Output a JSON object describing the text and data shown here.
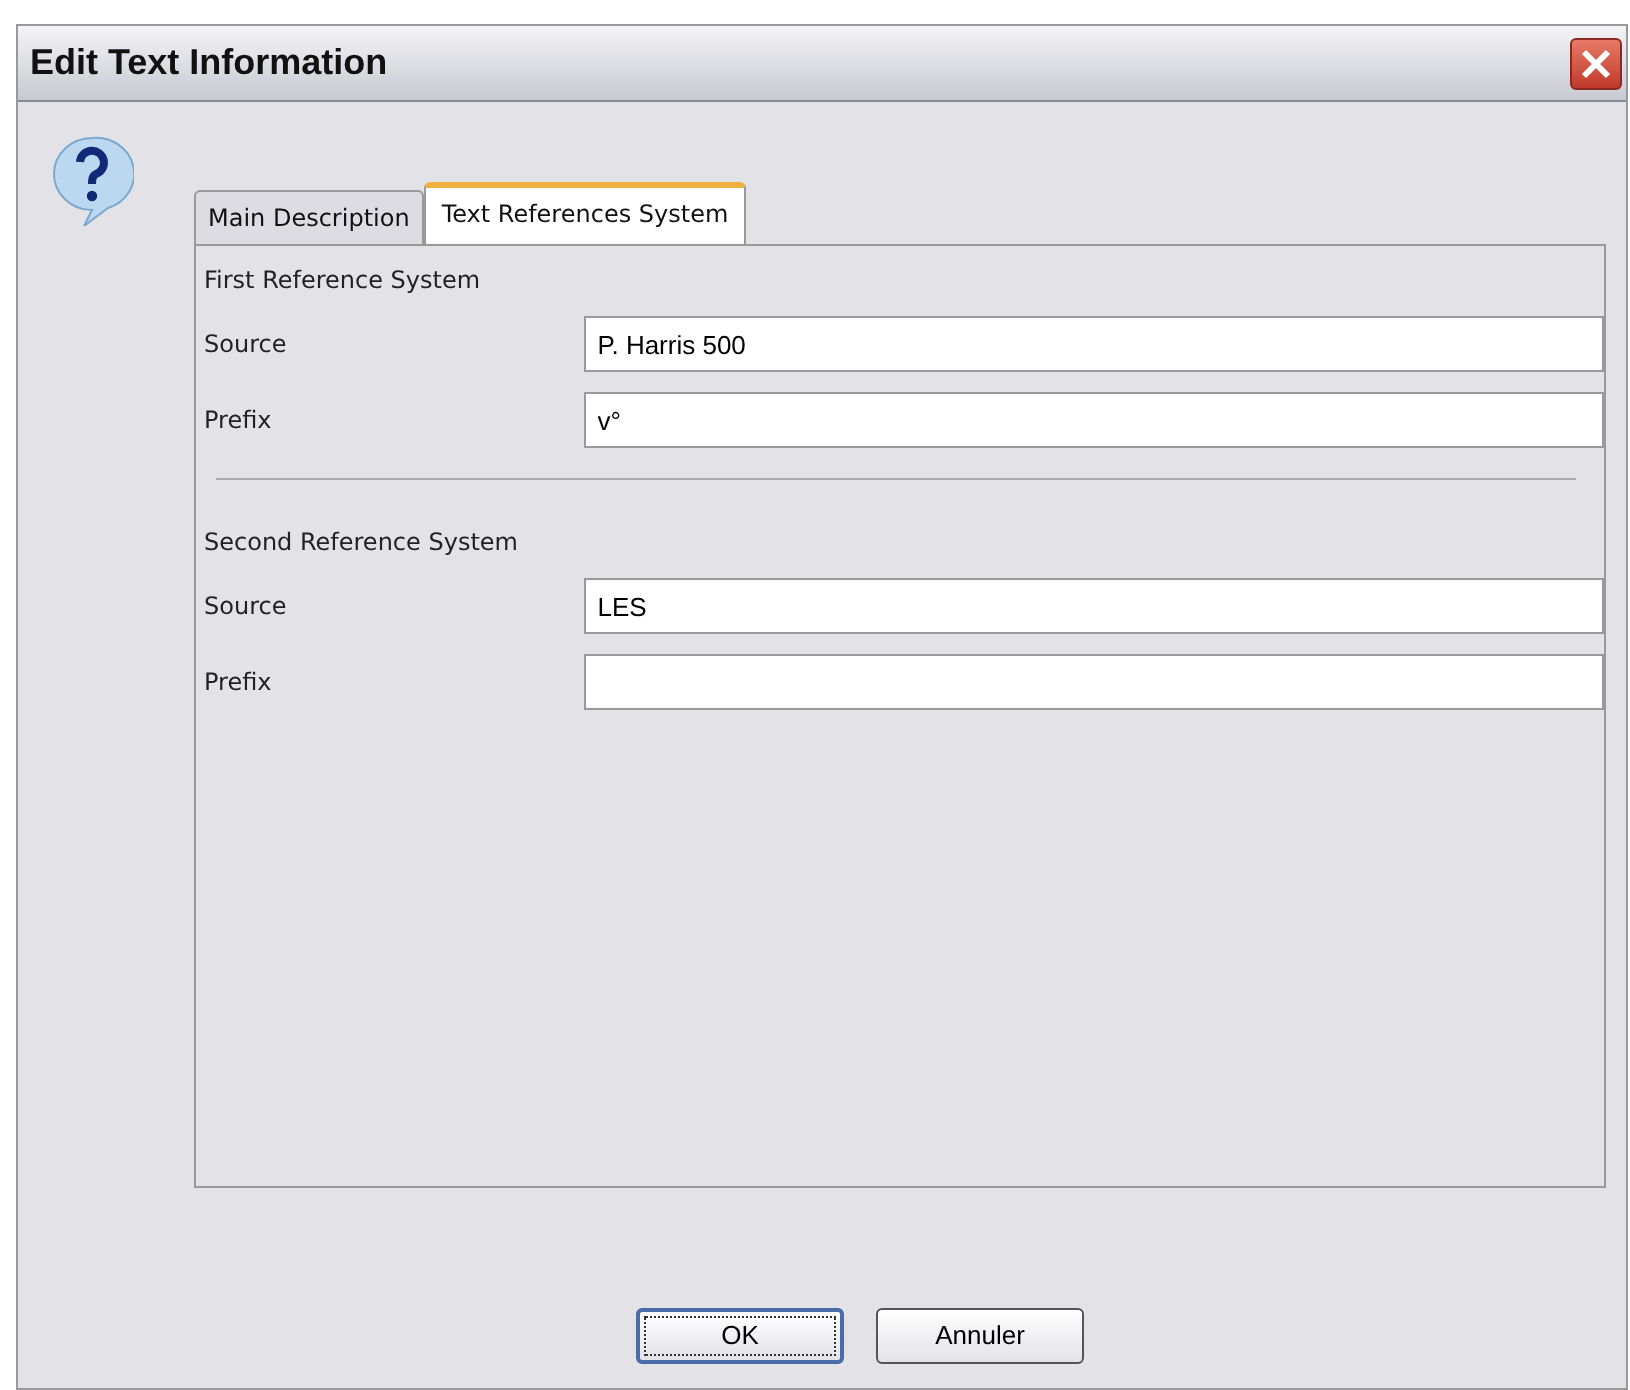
{
  "window": {
    "title": "Edit Text Information"
  },
  "tabs": [
    {
      "label": "Main Description",
      "selected": false
    },
    {
      "label": "Text References System",
      "selected": true
    }
  ],
  "sections": [
    {
      "title": "First Reference System",
      "fields": [
        {
          "label": "Source",
          "value": "P. Harris 500"
        },
        {
          "label": "Prefix",
          "value": "v°"
        }
      ]
    },
    {
      "title": "Second Reference System",
      "fields": [
        {
          "label": "Source",
          "value": "LES"
        },
        {
          "label": "Prefix"
        }
      ]
    }
  ],
  "buttons": [
    {
      "label": "OK",
      "selected": true
    },
    {
      "label": "Annuler",
      "selected": false
    }
  ]
}
